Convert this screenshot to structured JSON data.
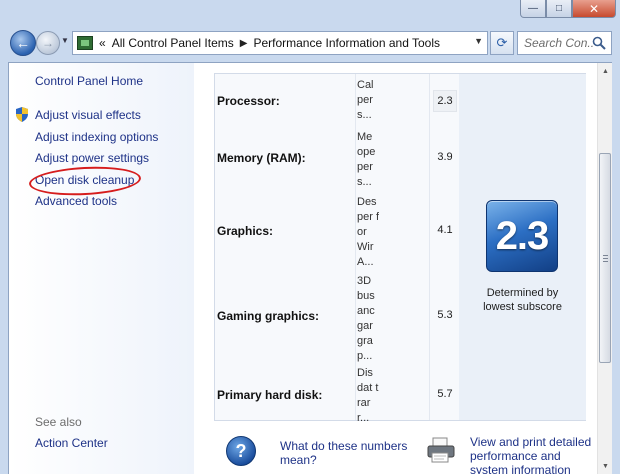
{
  "window": {
    "controls": {
      "minimize": "—",
      "maximize": "□",
      "close": "✕"
    }
  },
  "nav": {
    "breadcrumb_prefix": "«",
    "breadcrumb": [
      "All Control Panel Items",
      "Performance Information and Tools"
    ],
    "search_placeholder": "Search Con..."
  },
  "sidebar": {
    "home": "Control Panel Home",
    "items": [
      {
        "label": "Adjust visual effects",
        "icon": "shield-icon"
      },
      {
        "label": "Adjust indexing options"
      },
      {
        "label": "Adjust power settings"
      },
      {
        "label": "Open disk cleanup",
        "annotated": true
      },
      {
        "label": "Advanced tools"
      }
    ],
    "see_also_title": "See also",
    "see_also": [
      "Action Center"
    ]
  },
  "ratings": [
    {
      "component": "Processor:",
      "rates_this": "Calper s...",
      "subscore": "2.3"
    },
    {
      "component": "Memory (RAM):",
      "rates_this": "Me ope per s...",
      "subscore": "3.9"
    },
    {
      "component": "Graphics:",
      "rates_this": "Des per for Wir A...",
      "subscore": "4.1"
    },
    {
      "component": "Gaming graphics:",
      "rates_this": "3D bus anc gar gra p...",
      "subscore": "5.3"
    },
    {
      "component": "Primary hard disk:",
      "rates_this": "Dis dat trar r...",
      "subscore": "5.7"
    }
  ],
  "base_score": {
    "value": "2.3",
    "caption_line1": "Determined by",
    "caption_line2": "lowest subscore"
  },
  "links": {
    "numbers_help": "What do these numbers mean?",
    "print_details": "View and print detailed performance and system information"
  },
  "colors": {
    "link": "#1e3287",
    "annotation": "#d61d1d",
    "score_tile": "#2c6fc4"
  }
}
